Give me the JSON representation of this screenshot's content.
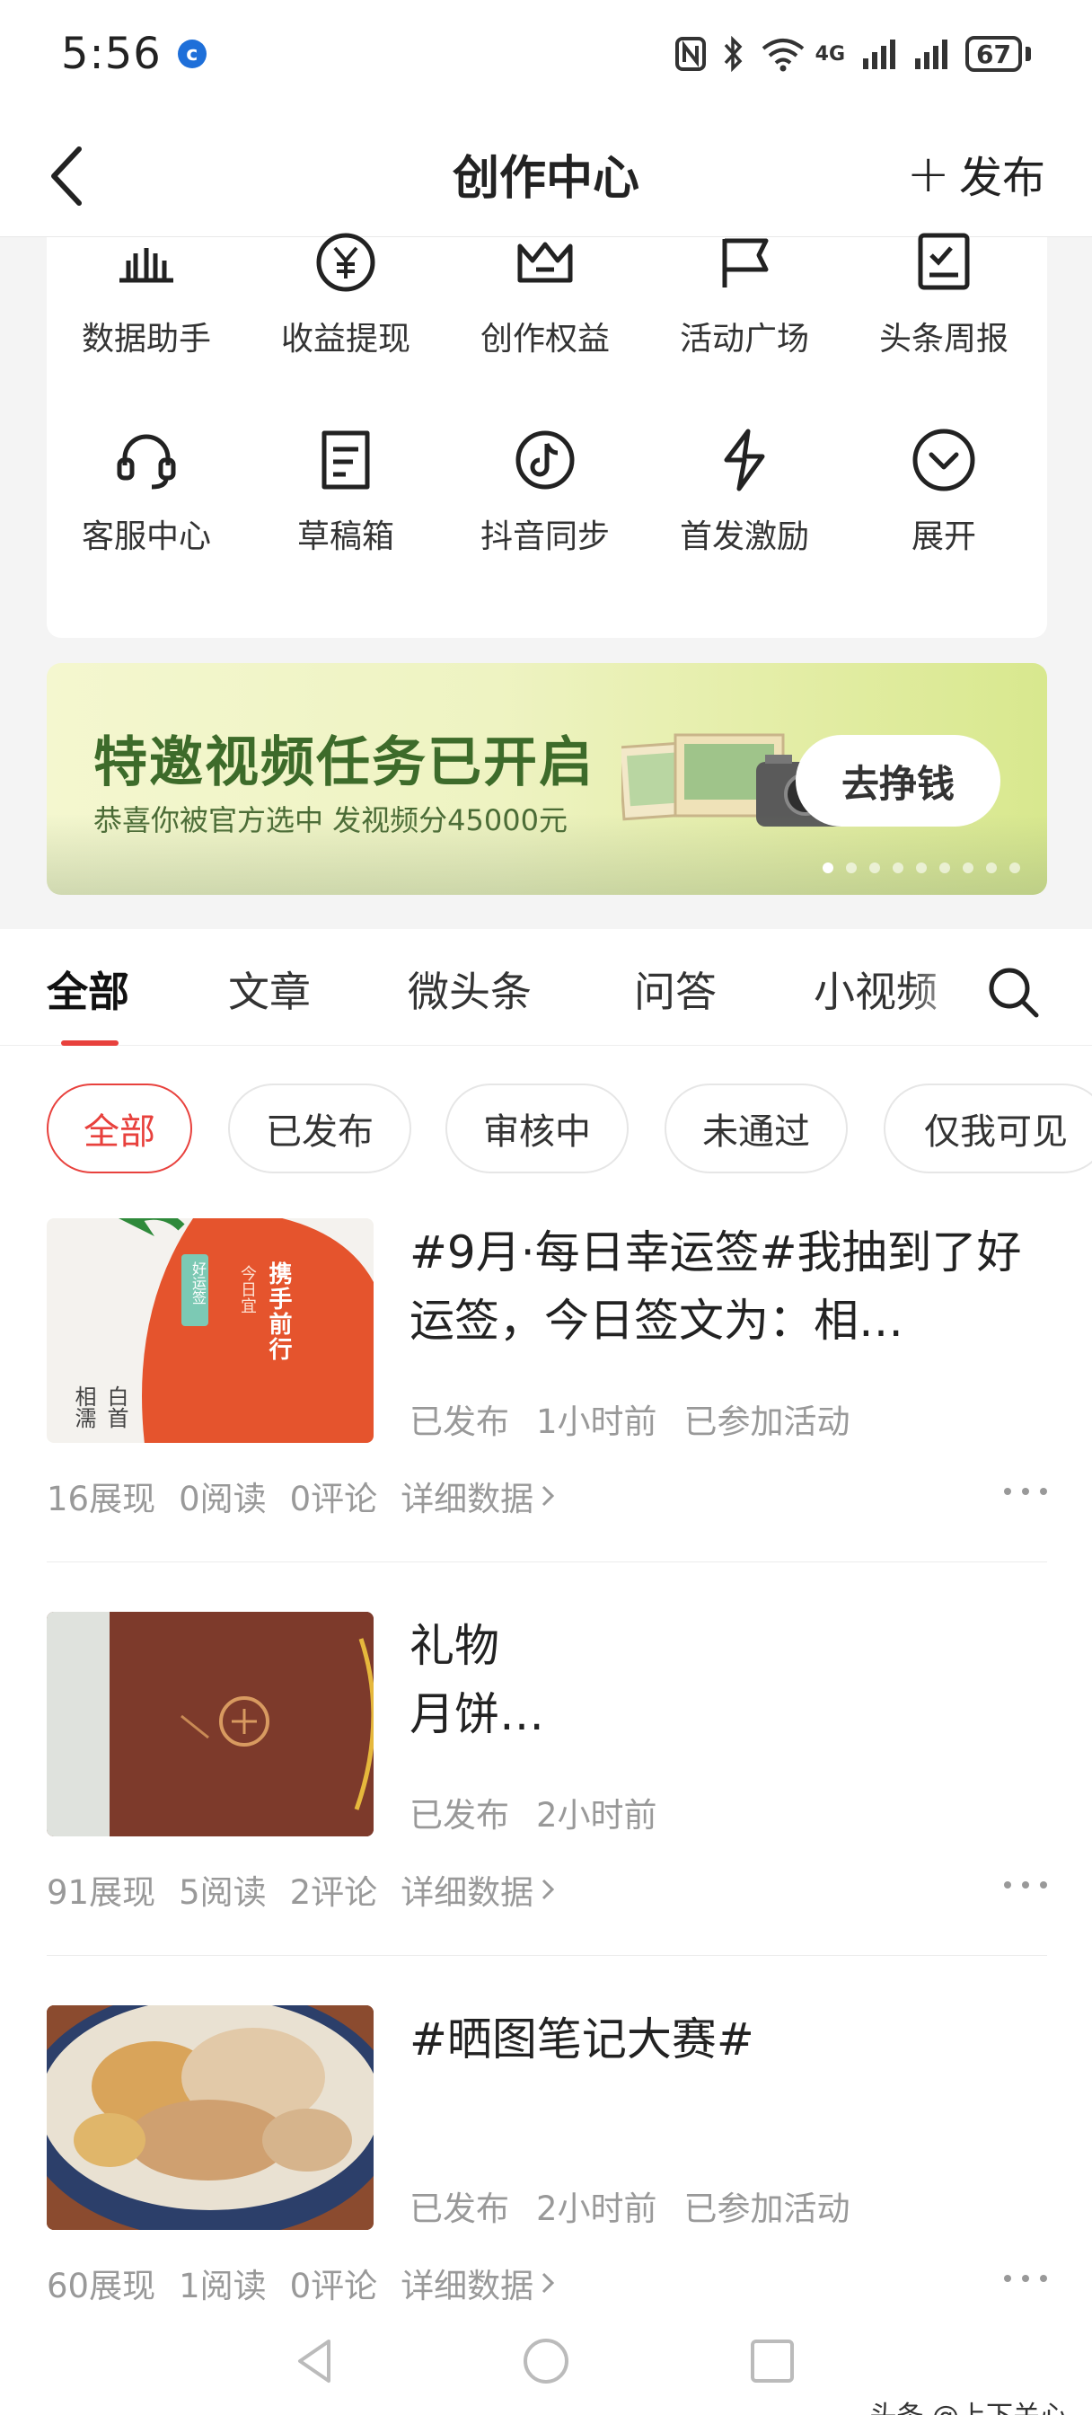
{
  "status_bar": {
    "time": "5:56",
    "wifi_label": "6",
    "network": "4G",
    "battery": "67"
  },
  "header": {
    "title": "创作中心",
    "publish_label": "发布"
  },
  "tools": [
    {
      "label": "数据助手",
      "icon": "bar-chart-icon"
    },
    {
      "label": "收益提现",
      "icon": "yuan-coin-icon"
    },
    {
      "label": "创作权益",
      "icon": "crown-icon"
    },
    {
      "label": "活动广场",
      "icon": "flag-icon"
    },
    {
      "label": "头条周报",
      "icon": "report-icon"
    },
    {
      "label": "客服中心",
      "icon": "headset-icon"
    },
    {
      "label": "草稿箱",
      "icon": "draft-icon"
    },
    {
      "label": "抖音同步",
      "icon": "douyin-icon"
    },
    {
      "label": "首发激励",
      "icon": "lightning-icon"
    },
    {
      "label": "展开",
      "icon": "chevron-down-icon"
    }
  ],
  "banner": {
    "title": "特邀视频任务已开启",
    "subtitle": "恭喜你被官方选中 发视频分45000元",
    "cta": "去挣钱",
    "dot_count": 9,
    "active_dot": 0
  },
  "content_tabs": [
    {
      "label": "全部",
      "active": true
    },
    {
      "label": "文章",
      "active": false
    },
    {
      "label": "微头条",
      "active": false
    },
    {
      "label": "问答",
      "active": false
    },
    {
      "label": "小视频",
      "active": false
    }
  ],
  "filters": [
    {
      "label": "全部",
      "active": true
    },
    {
      "label": "已发布",
      "active": false
    },
    {
      "label": "审核中",
      "active": false
    },
    {
      "label": "未通过",
      "active": false
    },
    {
      "label": "仅我可见",
      "active": false
    }
  ],
  "posts": [
    {
      "title": "#9月·每日幸运签#我抽到了好运签，今日签文为：相…",
      "thumb_text": {
        "tag": "好运签",
        "day": "今日宜",
        "phrase": "携手前行",
        "corner_a": "白首",
        "corner_b": "相濡"
      },
      "meta": [
        "已发布",
        "1小时前",
        "已参加活动"
      ],
      "stats": {
        "views": "16展现",
        "reads": "0阅读",
        "comments": "0评论",
        "detail": "详细数据"
      }
    },
    {
      "title": "礼物\n月饼…",
      "meta": [
        "已发布",
        "2小时前"
      ],
      "stats": {
        "views": "91展现",
        "reads": "5阅读",
        "comments": "2评论",
        "detail": "详细数据"
      }
    },
    {
      "title": "#晒图笔记大赛#",
      "meta": [
        "已发布",
        "2小时前",
        "已参加活动"
      ],
      "stats": {
        "views": "60展现",
        "reads": "1阅读",
        "comments": "0评论",
        "detail": "详细数据"
      }
    }
  ],
  "watermark": "头条 @上下关心",
  "colors": {
    "accent": "#e8413d",
    "banner_text": "#3d6b2a"
  }
}
